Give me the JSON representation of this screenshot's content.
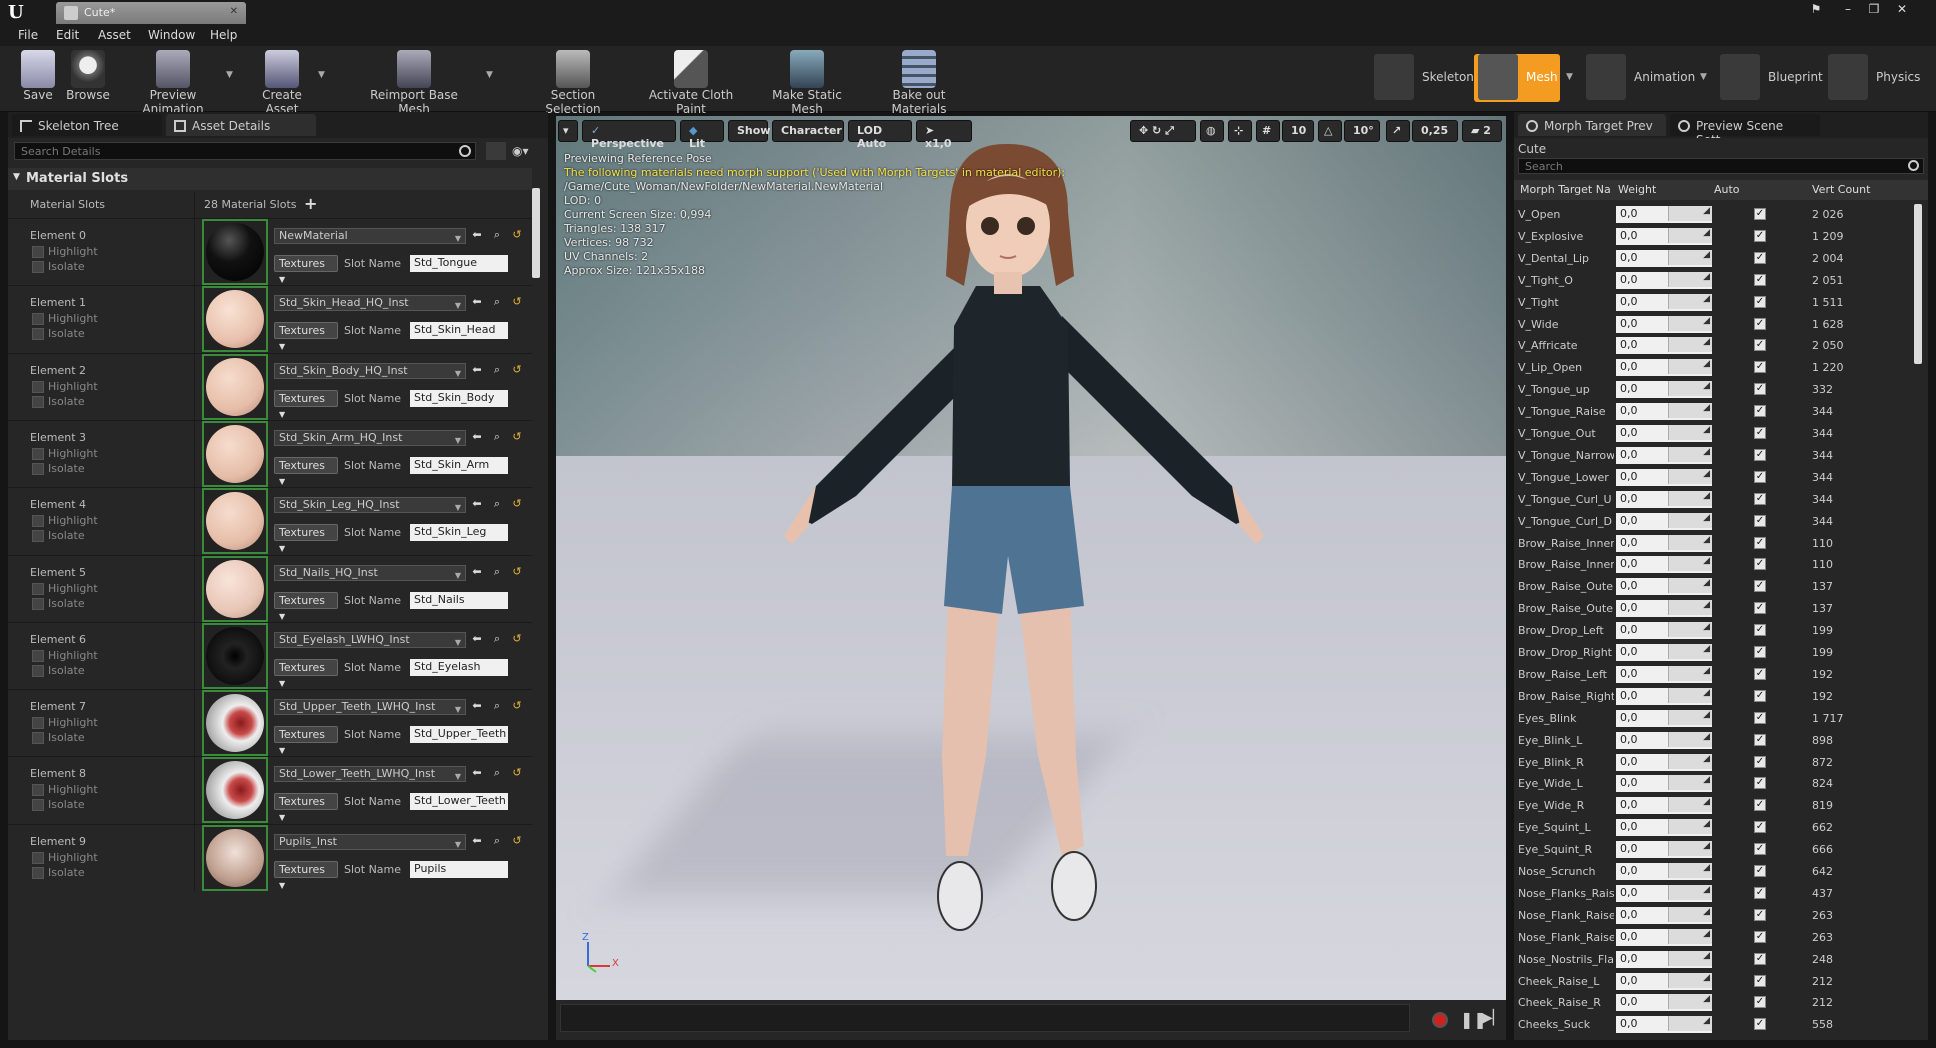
{
  "titlebar": {
    "tab_title": "Cute*"
  },
  "menu": [
    "File",
    "Edit",
    "Asset",
    "Window",
    "Help"
  ],
  "toolbar": {
    "buttons": [
      "Save",
      "Browse",
      "Preview Animation",
      "Create Asset",
      "Reimport Base Mesh",
      "Section Selection",
      "Activate Cloth Paint",
      "Make Static Mesh",
      "Bake out Materials"
    ],
    "modes": [
      "Skeleton",
      "Mesh",
      "Animation",
      "Blueprint",
      "Physics"
    ]
  },
  "left_panel": {
    "tabs": [
      "Skeleton Tree",
      "Asset Details"
    ],
    "search_placeholder": "Search Details",
    "section_title": "Material Slots",
    "slots_label": "Material Slots",
    "slots_count": "28 Material Slots",
    "highlight_label": "Highlight",
    "isolate_label": "Isolate",
    "textures_label": "Textures",
    "slot_name_label": "Slot Name",
    "elements": [
      {
        "name": "Element 0",
        "material": "NewMaterial",
        "slot": "Std_Tongue"
      },
      {
        "name": "Element 1",
        "material": "Std_Skin_Head_HQ_Inst",
        "slot": "Std_Skin_Head"
      },
      {
        "name": "Element 2",
        "material": "Std_Skin_Body_HQ_Inst",
        "slot": "Std_Skin_Body"
      },
      {
        "name": "Element 3",
        "material": "Std_Skin_Arm_HQ_Inst",
        "slot": "Std_Skin_Arm"
      },
      {
        "name": "Element 4",
        "material": "Std_Skin_Leg_HQ_Inst",
        "slot": "Std_Skin_Leg"
      },
      {
        "name": "Element 5",
        "material": "Std_Nails_HQ_Inst",
        "slot": "Std_Nails"
      },
      {
        "name": "Element 6",
        "material": "Std_Eyelash_LWHQ_Inst",
        "slot": "Std_Eyelash"
      },
      {
        "name": "Element 7",
        "material": "Std_Upper_Teeth_LWHQ_Inst",
        "slot": "Std_Upper_Teeth"
      },
      {
        "name": "Element 8",
        "material": "Std_Lower_Teeth_LWHQ_Inst",
        "slot": "Std_Lower_Teeth"
      },
      {
        "name": "Element 9",
        "material": "Pupils_Inst",
        "slot": "Pupils"
      }
    ]
  },
  "viewport": {
    "perspective": "Perspective",
    "lit": "Lit",
    "show": "Show",
    "character": "Character",
    "lod": "LOD Auto",
    "speed": "x1,0",
    "grid_snap": "10",
    "rot_snap": "10°",
    "scale_snap": "0,25",
    "cam_speed": "2",
    "info": [
      "Previewing Reference Pose",
      "The following materials need morph support ('Used with Morph Targets' in material editor):",
      "/Game/Cute_Woman/NewFolder/NewMaterial.NewMaterial",
      "LOD: 0",
      "Current Screen Size: 0,994",
      "Triangles: 138 317",
      "Vertices: 98 732",
      "UV Channels: 2",
      "Approx Size: 121x35x188"
    ],
    "axis_z": "Z",
    "axis_x": "X"
  },
  "right_panel": {
    "tabs": [
      "Morph Target Prev",
      "Preview Scene Sett"
    ],
    "asset": "Cute",
    "search_placeholder": "Search",
    "columns": [
      "Morph Target Na",
      "Weight",
      "Auto",
      "Vert Count"
    ],
    "rows": [
      {
        "name": "V_Open",
        "weight": "0,0",
        "verts": "2 026"
      },
      {
        "name": "V_Explosive",
        "weight": "0,0",
        "verts": "1 209"
      },
      {
        "name": "V_Dental_Lip",
        "weight": "0,0",
        "verts": "2 004"
      },
      {
        "name": "V_Tight_O",
        "weight": "0,0",
        "verts": "2 051"
      },
      {
        "name": "V_Tight",
        "weight": "0,0",
        "verts": "1 511"
      },
      {
        "name": "V_Wide",
        "weight": "0,0",
        "verts": "1 628"
      },
      {
        "name": "V_Affricate",
        "weight": "0,0",
        "verts": "2 050"
      },
      {
        "name": "V_Lip_Open",
        "weight": "0,0",
        "verts": "1 220"
      },
      {
        "name": "V_Tongue_up",
        "weight": "0,0",
        "verts": "332"
      },
      {
        "name": "V_Tongue_Raise",
        "weight": "0,0",
        "verts": "344"
      },
      {
        "name": "V_Tongue_Out",
        "weight": "0,0",
        "verts": "344"
      },
      {
        "name": "V_Tongue_Narrow",
        "weight": "0,0",
        "verts": "344"
      },
      {
        "name": "V_Tongue_Lower",
        "weight": "0,0",
        "verts": "344"
      },
      {
        "name": "V_Tongue_Curl_U",
        "weight": "0,0",
        "verts": "344"
      },
      {
        "name": "V_Tongue_Curl_D",
        "weight": "0,0",
        "verts": "344"
      },
      {
        "name": "Brow_Raise_Inner",
        "weight": "0,0",
        "verts": "110"
      },
      {
        "name": "Brow_Raise_Inner",
        "weight": "0,0",
        "verts": "110"
      },
      {
        "name": "Brow_Raise_Outer",
        "weight": "0,0",
        "verts": "137"
      },
      {
        "name": "Brow_Raise_Outer",
        "weight": "0,0",
        "verts": "137"
      },
      {
        "name": "Brow_Drop_Left",
        "weight": "0,0",
        "verts": "199"
      },
      {
        "name": "Brow_Drop_Right",
        "weight": "0,0",
        "verts": "199"
      },
      {
        "name": "Brow_Raise_Left",
        "weight": "0,0",
        "verts": "192"
      },
      {
        "name": "Brow_Raise_Right",
        "weight": "0,0",
        "verts": "192"
      },
      {
        "name": "Eyes_Blink",
        "weight": "0,0",
        "verts": "1 717"
      },
      {
        "name": "Eye_Blink_L",
        "weight": "0,0",
        "verts": "898"
      },
      {
        "name": "Eye_Blink_R",
        "weight": "0,0",
        "verts": "872"
      },
      {
        "name": "Eye_Wide_L",
        "weight": "0,0",
        "verts": "824"
      },
      {
        "name": "Eye_Wide_R",
        "weight": "0,0",
        "verts": "819"
      },
      {
        "name": "Eye_Squint_L",
        "weight": "0,0",
        "verts": "662"
      },
      {
        "name": "Eye_Squint_R",
        "weight": "0,0",
        "verts": "666"
      },
      {
        "name": "Nose_Scrunch",
        "weight": "0,0",
        "verts": "642"
      },
      {
        "name": "Nose_Flanks_Raise",
        "weight": "0,0",
        "verts": "437"
      },
      {
        "name": "Nose_Flank_Raise",
        "weight": "0,0",
        "verts": "263"
      },
      {
        "name": "Nose_Flank_Raise",
        "weight": "0,0",
        "verts": "263"
      },
      {
        "name": "Nose_Nostrils_Flare",
        "weight": "0,0",
        "verts": "248"
      },
      {
        "name": "Cheek_Raise_L",
        "weight": "0,0",
        "verts": "212"
      },
      {
        "name": "Cheek_Raise_R",
        "weight": "0,0",
        "verts": "212"
      },
      {
        "name": "Cheeks_Suck",
        "weight": "0,0",
        "verts": "558"
      }
    ]
  }
}
